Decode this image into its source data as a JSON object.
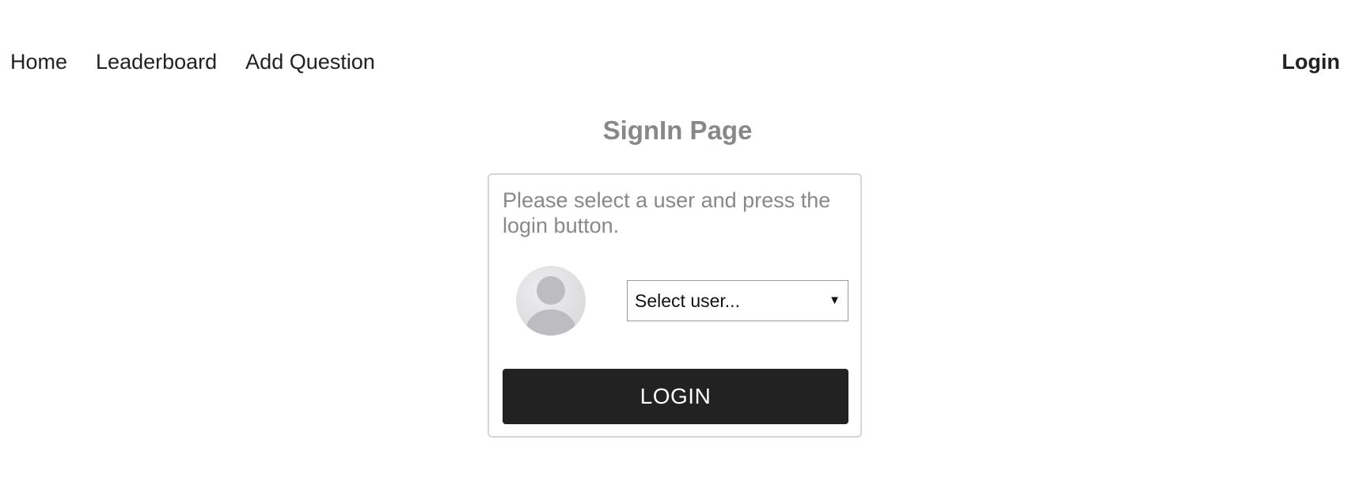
{
  "nav": {
    "items": [
      {
        "label": "Home"
      },
      {
        "label": "Leaderboard"
      },
      {
        "label": "Add Question"
      }
    ],
    "login_label": "Login"
  },
  "page": {
    "title": "SignIn Page"
  },
  "signin_card": {
    "instructions": "Please select a user and press the login button.",
    "avatar_icon": "user-placeholder-icon",
    "user_select": {
      "selected": "Select user...",
      "arrow_glyph": "▼"
    },
    "login_button_label": "LOGIN"
  },
  "colors": {
    "text": "#222222",
    "muted_text": "#888888",
    "button_bg": "#222222",
    "button_text": "#ffffff",
    "card_border": "#d6d6d6"
  }
}
